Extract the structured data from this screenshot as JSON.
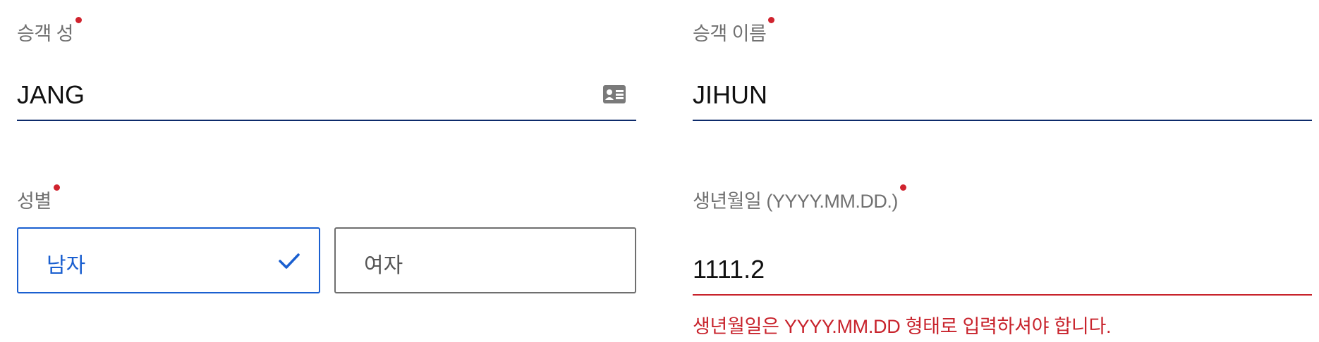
{
  "surname": {
    "label": "승객 성",
    "value": "JANG"
  },
  "given_name": {
    "label": "승객 이름",
    "value": "JIHUN"
  },
  "gender": {
    "label": "성별",
    "options": [
      "남자",
      "여자"
    ],
    "selected": "남자"
  },
  "birthdate": {
    "label": "생년월일 (YYYY.MM.DD.)",
    "value": "1111.2",
    "error": "생년월일은 YYYY.MM.DD 형태로 입력하셔야 합니다."
  },
  "colors": {
    "required_dot": "#d0232e",
    "accent": "#1a5fd0",
    "underline": "#0d2b6b",
    "error": "#c8232c"
  },
  "icons": {
    "surname_field": "id-card-icon",
    "selected_option": "check-icon"
  }
}
